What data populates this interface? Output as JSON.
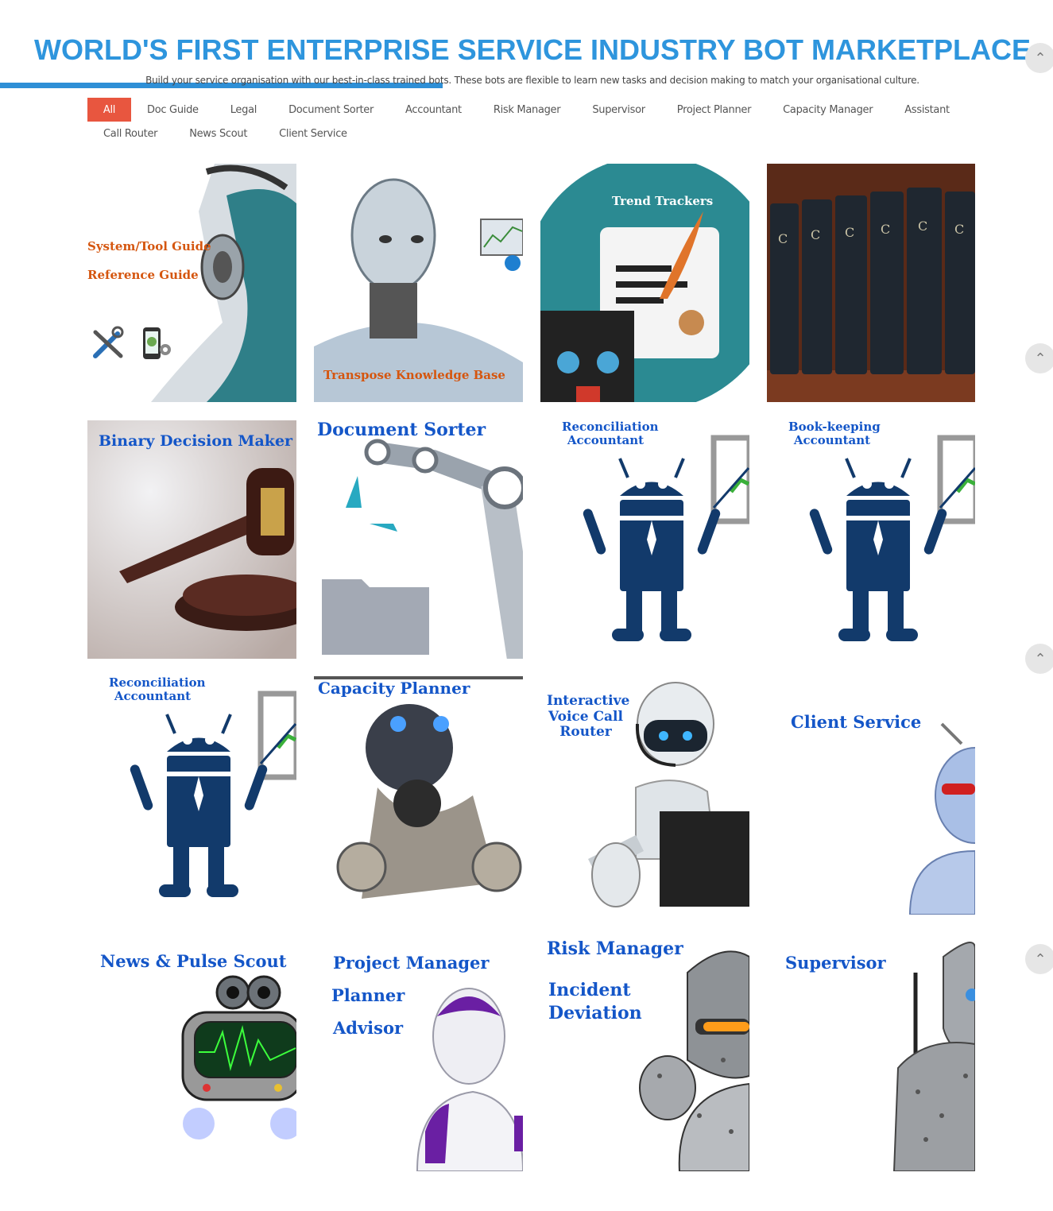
{
  "header": {
    "title": "WORLD'S FIRST ENTERPRISE SERVICE INDUSTRY BOT MARKETPLACE",
    "subtitle": "Build your service organisation with our best-in-class trained bots. These bots are flexible to learn new tasks and decision making to match your organisational culture.",
    "progress_percent": 42
  },
  "filters": {
    "row1": [
      "All",
      "Doc Guide",
      "Legal",
      "Document Sorter",
      "Accountant",
      "Risk Manager",
      "Supervisor",
      "Project Planner",
      "Capacity Manager",
      "Assistant"
    ],
    "row2": [
      "Call Router",
      "News Scout",
      "Client Service"
    ],
    "active": "All"
  },
  "tiles": {
    "system_guide": {
      "line1": "System/Tool Guide",
      "line2": "Reference Guide",
      "icons": [
        "tools-icon",
        "mobile-gear-icon"
      ]
    },
    "transpose": {
      "label": "Transpose  Knowledge Base"
    },
    "trend_trackers": {
      "label": "Trend Trackers"
    },
    "law_books": {
      "spine_text": "CCH"
    },
    "binary_decision": {
      "label": "Binary Decision Maker"
    },
    "document_sorter": {
      "label": "Document Sorter"
    },
    "reconciliation_1": {
      "line1": "Reconciliation",
      "line2": "Accountant"
    },
    "bookkeeping": {
      "line1": "Book-keeping",
      "line2": "Accountant"
    },
    "reconciliation_2": {
      "line1": "Reconciliation",
      "line2": "Accountant"
    },
    "capacity_planner": {
      "label": "Capacity Planner"
    },
    "voice_call_router": {
      "line1": "Interactive",
      "line2": "Voice Call",
      "line3": "Router"
    },
    "client_service": {
      "label": "Client Service"
    },
    "news_scout": {
      "label": "News & Pulse Scout"
    },
    "project_manager": {
      "line1": "Project Manager",
      "line2": "Planner",
      "line3": "Advisor"
    },
    "risk_manager": {
      "line1": "Risk Manager",
      "line2": "Incident",
      "line3": "Deviation"
    },
    "supervisor": {
      "label": "Supervisor"
    }
  },
  "side_controls": {
    "icon": "chevron-up-icon",
    "count": 4
  },
  "colors": {
    "title_blue": "#2e95dd",
    "active_filter": "#e8563f",
    "label_orange": "#d5560f",
    "label_blue": "#1456c8",
    "bot_navy": "#123a6b"
  }
}
